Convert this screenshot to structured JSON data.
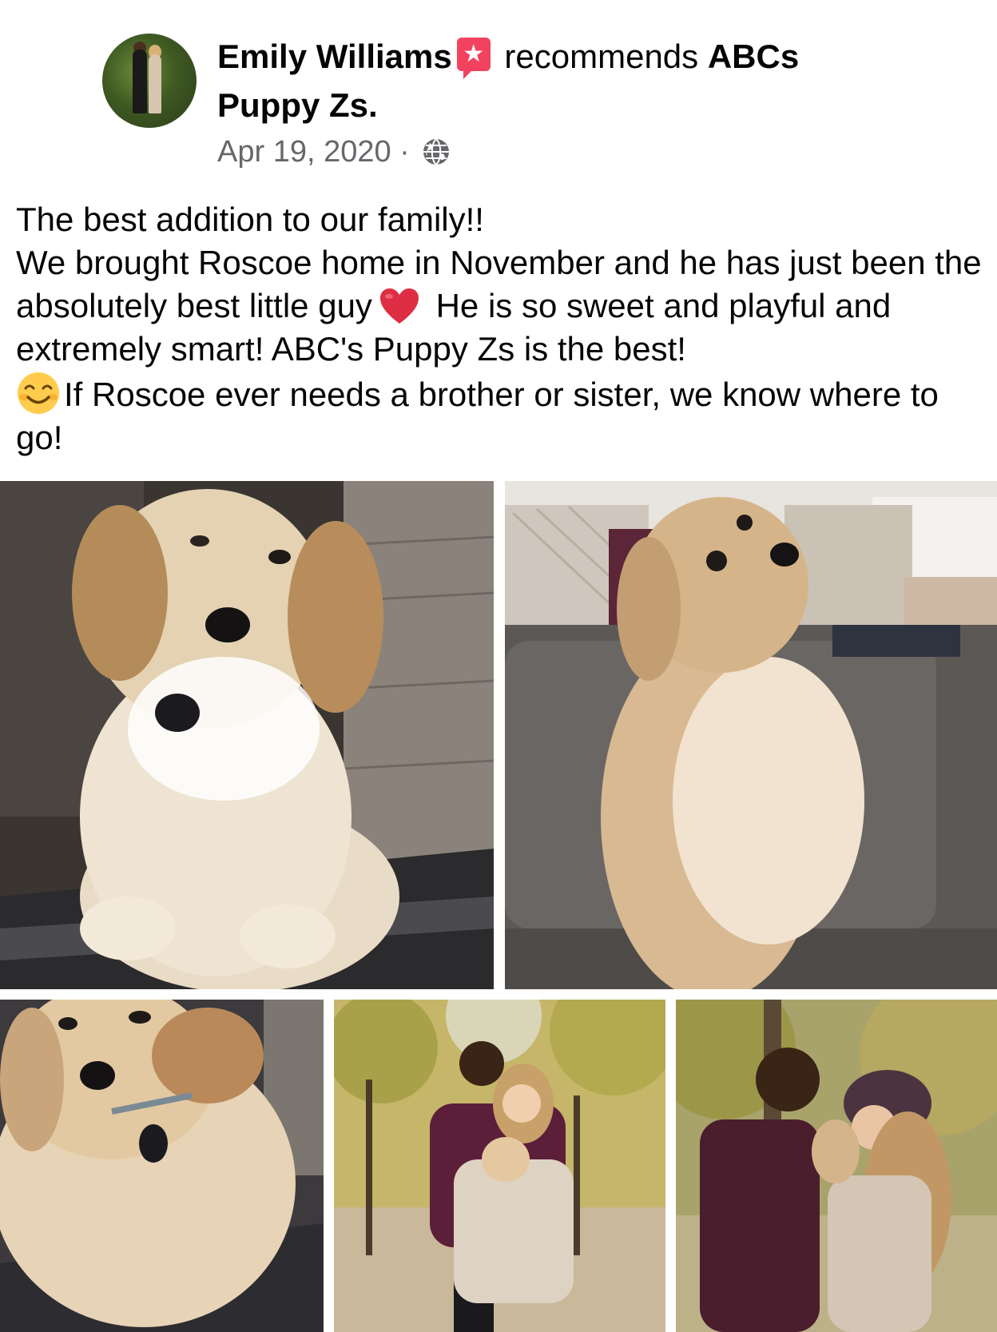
{
  "post": {
    "author": "Emily Williams",
    "action": "recommends",
    "page_name_part1": "ABCs",
    "page_name_part2": "Puppy Zs.",
    "date": "Apr 19, 2020",
    "separator": "·",
    "privacy_icon": "globe-icon",
    "recommend_icon": "recommend-star-icon",
    "accent_color": "#f3425f",
    "body": {
      "line1": "The best addition to our family!!",
      "line2a": "We brought Roscoe home in November and he has just been the absolutely best little guy",
      "line2b": " He is so sweet and playful and extremely smart! ABC's Puppy Zs is the best! ",
      "line2c": "If Roscoe ever needs a brother or sister, we know where to go!"
    },
    "photos": [
      {
        "alt": "puppy-sitting-on-couch"
      },
      {
        "alt": "puppy-standing-on-couch"
      },
      {
        "alt": "puppy-lying-close-up"
      },
      {
        "alt": "couple-holding-puppy"
      },
      {
        "alt": "couple-kissing-with-puppy"
      }
    ]
  }
}
